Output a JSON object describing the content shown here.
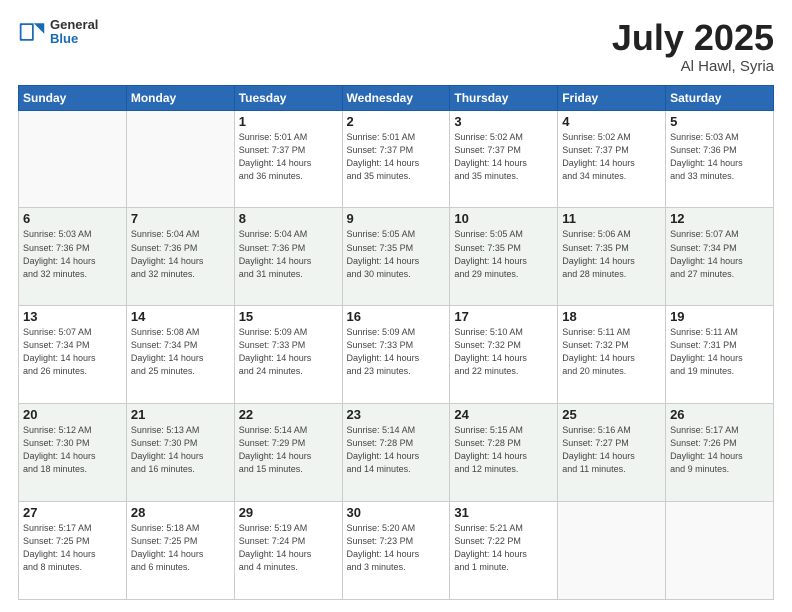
{
  "header": {
    "logo_general": "General",
    "logo_blue": "Blue",
    "title": "July 2025",
    "location": "Al Hawl, Syria"
  },
  "weekdays": [
    "Sunday",
    "Monday",
    "Tuesday",
    "Wednesday",
    "Thursday",
    "Friday",
    "Saturday"
  ],
  "weeks": [
    [
      {
        "day": "",
        "info": ""
      },
      {
        "day": "",
        "info": ""
      },
      {
        "day": "1",
        "info": "Sunrise: 5:01 AM\nSunset: 7:37 PM\nDaylight: 14 hours\nand 36 minutes."
      },
      {
        "day": "2",
        "info": "Sunrise: 5:01 AM\nSunset: 7:37 PM\nDaylight: 14 hours\nand 35 minutes."
      },
      {
        "day": "3",
        "info": "Sunrise: 5:02 AM\nSunset: 7:37 PM\nDaylight: 14 hours\nand 35 minutes."
      },
      {
        "day": "4",
        "info": "Sunrise: 5:02 AM\nSunset: 7:37 PM\nDaylight: 14 hours\nand 34 minutes."
      },
      {
        "day": "5",
        "info": "Sunrise: 5:03 AM\nSunset: 7:36 PM\nDaylight: 14 hours\nand 33 minutes."
      }
    ],
    [
      {
        "day": "6",
        "info": "Sunrise: 5:03 AM\nSunset: 7:36 PM\nDaylight: 14 hours\nand 32 minutes."
      },
      {
        "day": "7",
        "info": "Sunrise: 5:04 AM\nSunset: 7:36 PM\nDaylight: 14 hours\nand 32 minutes."
      },
      {
        "day": "8",
        "info": "Sunrise: 5:04 AM\nSunset: 7:36 PM\nDaylight: 14 hours\nand 31 minutes."
      },
      {
        "day": "9",
        "info": "Sunrise: 5:05 AM\nSunset: 7:35 PM\nDaylight: 14 hours\nand 30 minutes."
      },
      {
        "day": "10",
        "info": "Sunrise: 5:05 AM\nSunset: 7:35 PM\nDaylight: 14 hours\nand 29 minutes."
      },
      {
        "day": "11",
        "info": "Sunrise: 5:06 AM\nSunset: 7:35 PM\nDaylight: 14 hours\nand 28 minutes."
      },
      {
        "day": "12",
        "info": "Sunrise: 5:07 AM\nSunset: 7:34 PM\nDaylight: 14 hours\nand 27 minutes."
      }
    ],
    [
      {
        "day": "13",
        "info": "Sunrise: 5:07 AM\nSunset: 7:34 PM\nDaylight: 14 hours\nand 26 minutes."
      },
      {
        "day": "14",
        "info": "Sunrise: 5:08 AM\nSunset: 7:34 PM\nDaylight: 14 hours\nand 25 minutes."
      },
      {
        "day": "15",
        "info": "Sunrise: 5:09 AM\nSunset: 7:33 PM\nDaylight: 14 hours\nand 24 minutes."
      },
      {
        "day": "16",
        "info": "Sunrise: 5:09 AM\nSunset: 7:33 PM\nDaylight: 14 hours\nand 23 minutes."
      },
      {
        "day": "17",
        "info": "Sunrise: 5:10 AM\nSunset: 7:32 PM\nDaylight: 14 hours\nand 22 minutes."
      },
      {
        "day": "18",
        "info": "Sunrise: 5:11 AM\nSunset: 7:32 PM\nDaylight: 14 hours\nand 20 minutes."
      },
      {
        "day": "19",
        "info": "Sunrise: 5:11 AM\nSunset: 7:31 PM\nDaylight: 14 hours\nand 19 minutes."
      }
    ],
    [
      {
        "day": "20",
        "info": "Sunrise: 5:12 AM\nSunset: 7:30 PM\nDaylight: 14 hours\nand 18 minutes."
      },
      {
        "day": "21",
        "info": "Sunrise: 5:13 AM\nSunset: 7:30 PM\nDaylight: 14 hours\nand 16 minutes."
      },
      {
        "day": "22",
        "info": "Sunrise: 5:14 AM\nSunset: 7:29 PM\nDaylight: 14 hours\nand 15 minutes."
      },
      {
        "day": "23",
        "info": "Sunrise: 5:14 AM\nSunset: 7:28 PM\nDaylight: 14 hours\nand 14 minutes."
      },
      {
        "day": "24",
        "info": "Sunrise: 5:15 AM\nSunset: 7:28 PM\nDaylight: 14 hours\nand 12 minutes."
      },
      {
        "day": "25",
        "info": "Sunrise: 5:16 AM\nSunset: 7:27 PM\nDaylight: 14 hours\nand 11 minutes."
      },
      {
        "day": "26",
        "info": "Sunrise: 5:17 AM\nSunset: 7:26 PM\nDaylight: 14 hours\nand 9 minutes."
      }
    ],
    [
      {
        "day": "27",
        "info": "Sunrise: 5:17 AM\nSunset: 7:25 PM\nDaylight: 14 hours\nand 8 minutes."
      },
      {
        "day": "28",
        "info": "Sunrise: 5:18 AM\nSunset: 7:25 PM\nDaylight: 14 hours\nand 6 minutes."
      },
      {
        "day": "29",
        "info": "Sunrise: 5:19 AM\nSunset: 7:24 PM\nDaylight: 14 hours\nand 4 minutes."
      },
      {
        "day": "30",
        "info": "Sunrise: 5:20 AM\nSunset: 7:23 PM\nDaylight: 14 hours\nand 3 minutes."
      },
      {
        "day": "31",
        "info": "Sunrise: 5:21 AM\nSunset: 7:22 PM\nDaylight: 14 hours\nand 1 minute."
      },
      {
        "day": "",
        "info": ""
      },
      {
        "day": "",
        "info": ""
      }
    ]
  ]
}
